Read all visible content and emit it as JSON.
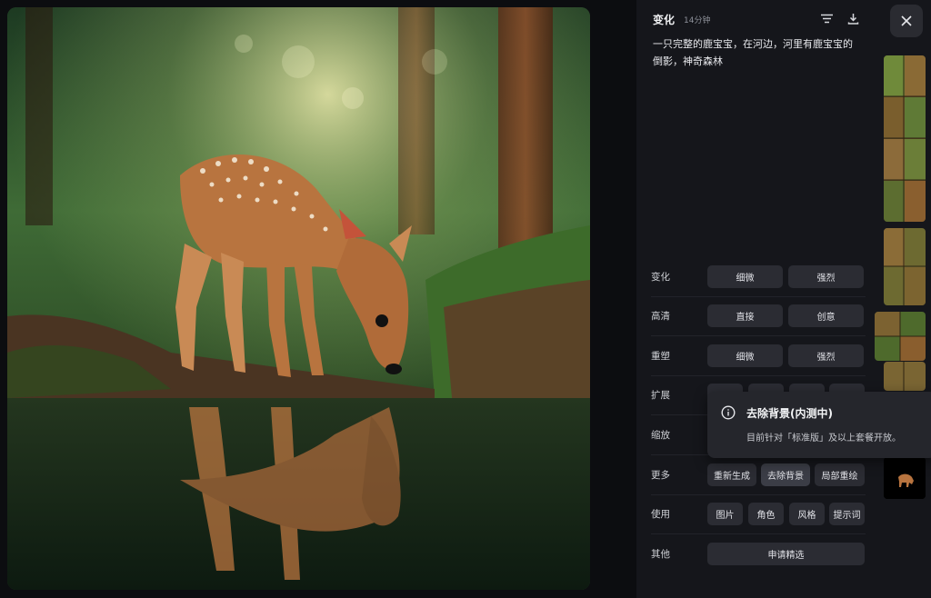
{
  "header": {
    "title": "变化",
    "time": "14分钟",
    "icons": [
      "filter-lines-icon",
      "download-icon"
    ]
  },
  "prompt": {
    "line1": "一只完整的鹿宝宝，在河边，河里有鹿宝宝的",
    "line2": "倒影，神奇森林"
  },
  "controls": {
    "variation": {
      "label": "变化",
      "subtle": "细微",
      "strong": "强烈"
    },
    "hd": {
      "label": "高清",
      "direct": "直接",
      "creative": "创意"
    },
    "reshape": {
      "label": "重塑",
      "subtle": "细微",
      "strong": "强烈"
    },
    "expand": {
      "label": "扩展"
    },
    "zoom": {
      "label": "缩放"
    },
    "more": {
      "label": "更多",
      "regenerate": "重新生成",
      "remove_bg": "去除背景",
      "inpaint": "局部重绘"
    },
    "use": {
      "label": "使用",
      "image": "图片",
      "character": "角色",
      "style": "风格",
      "prompt_word": "提示词"
    },
    "other": {
      "label": "其他",
      "apply_featured": "申请精选"
    }
  },
  "tooltip": {
    "title": "去除背景(内测中)",
    "description": "目前针对「标准版」及以上套餐开放。",
    "icon": "info-circle-icon"
  },
  "close": {
    "icon": "close-icon"
  },
  "colors": {
    "panel_bg": "#15161b",
    "button_bg": "#2b2c33",
    "tooltip_bg": "#25262c"
  }
}
